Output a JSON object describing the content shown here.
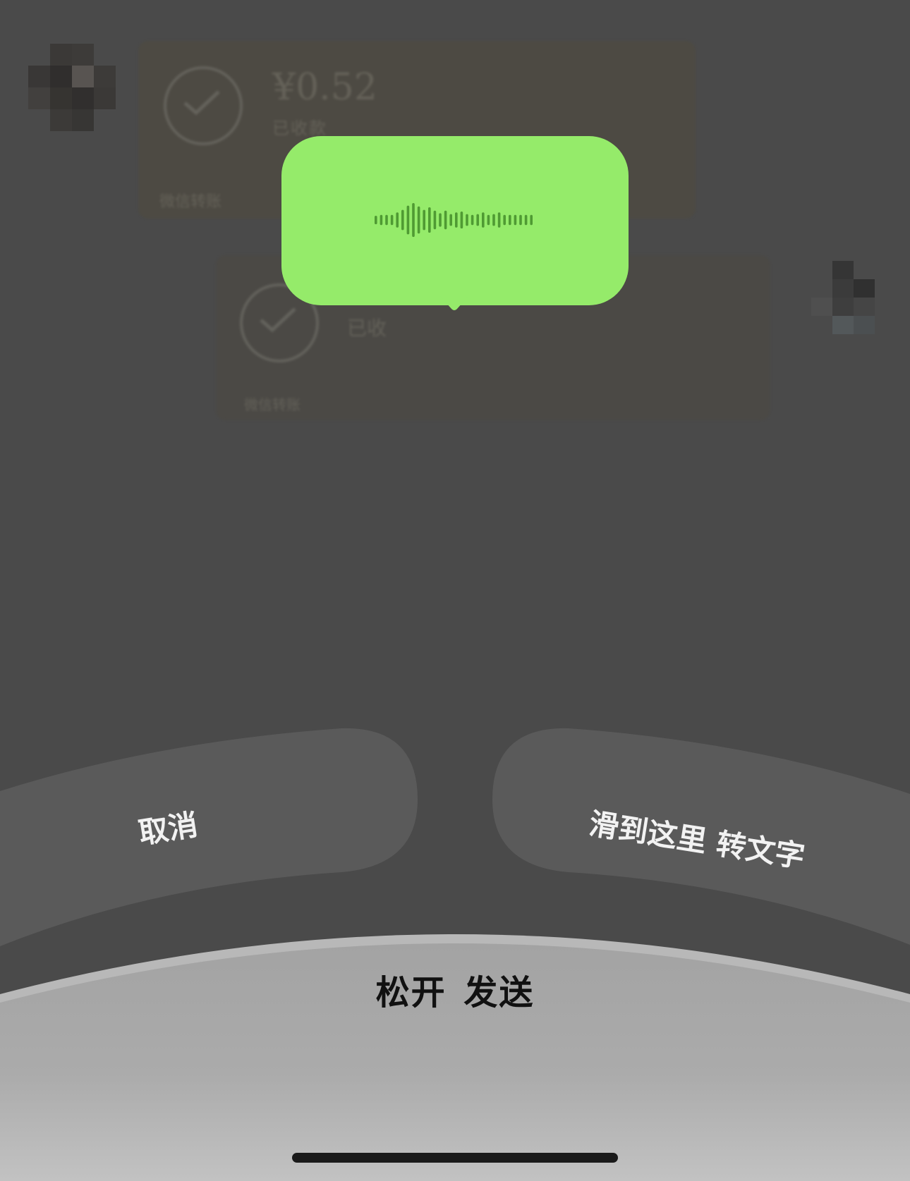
{
  "chat": {
    "incoming": {
      "amount": "¥0.52",
      "subtitle": "已收款",
      "footer": "微信转账"
    },
    "outgoing": {
      "subtitle": "已收",
      "footer": "微信转账"
    }
  },
  "recording": {
    "state": "recording",
    "bubble_color": "#95eb6a",
    "waveform_color": "#4f9a33",
    "waveform_levels": [
      0.25,
      0.3,
      0.3,
      0.3,
      0.45,
      0.6,
      0.85,
      1.0,
      0.8,
      0.6,
      0.75,
      0.55,
      0.4,
      0.55,
      0.35,
      0.45,
      0.5,
      0.35,
      0.3,
      0.35,
      0.45,
      0.3,
      0.35,
      0.45,
      0.3,
      0.3,
      0.3,
      0.3,
      0.3,
      0.3
    ]
  },
  "actions": {
    "cancel_label": "取消",
    "convert_label": "滑到这里 转文字",
    "release_label": "松开 发送"
  },
  "colors": {
    "background": "#4a4a4a",
    "pill": "#5a5a5a",
    "release_area_top": "#a5a5a5",
    "release_area_bottom": "#c1c1c1"
  }
}
